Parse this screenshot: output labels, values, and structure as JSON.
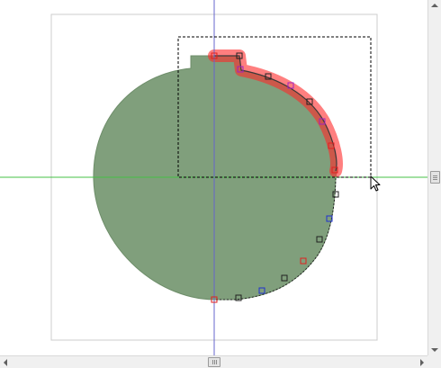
{
  "canvas": {
    "colors": {
      "shape_fill": "#809f7c",
      "shape_stroke": "#6e8e6a",
      "selection_highlight": "#ff2a2a",
      "path_stroke": "#3a3a3a",
      "node_red": "#e02020",
      "node_black": "#202020",
      "node_blue": "#2030d0",
      "node_purple": "#a020c0",
      "guide_vertical": "#6666cc",
      "guide_horizontal": "#44c044",
      "page_border": "#cccccc",
      "bbox_dash": "#000000"
    },
    "cursor_icon": "arrow-pointer-icon"
  },
  "scrollbars": {
    "vertical_icon_up": "triangle-up-icon",
    "vertical_icon_down": "triangle-down-icon",
    "horizontal_icon_left": "triangle-left-icon",
    "horizontal_icon_right": "triangle-right-icon"
  }
}
